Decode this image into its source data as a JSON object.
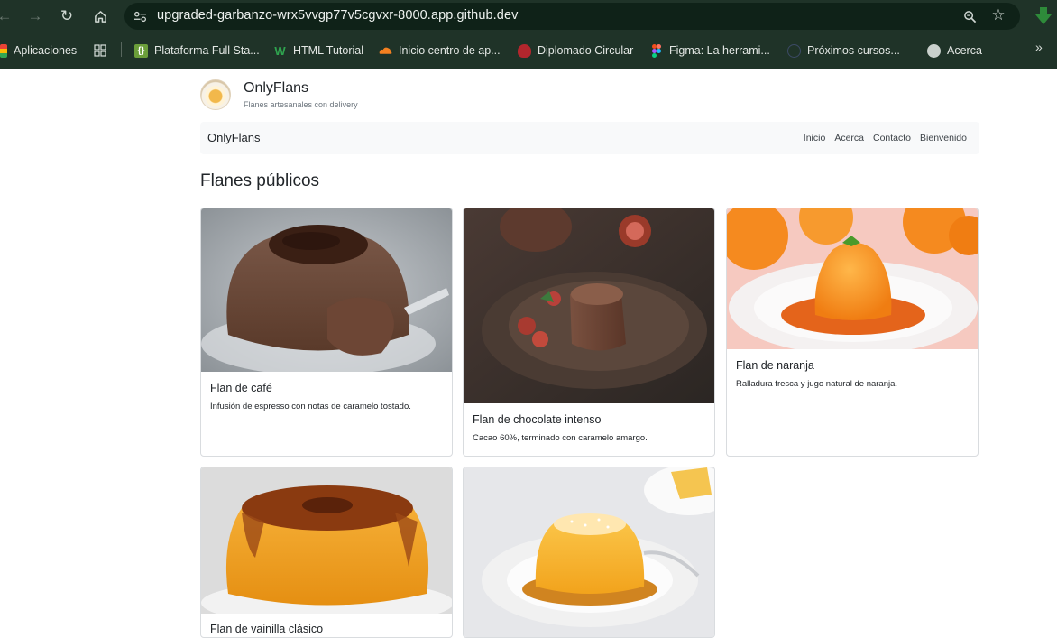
{
  "browser": {
    "url": "upgraded-garbanzo-wrx5vvgp77v5cgvxr-8000.app.github.dev",
    "bookmarks": [
      {
        "label": "Aplicaciones",
        "icon": "apps-grid-icon"
      },
      {
        "label": "Plataforma Full Sta...",
        "icon": "braces-icon"
      },
      {
        "label": "HTML Tutorial",
        "icon": "w3-icon"
      },
      {
        "label": "Inicio centro de ap...",
        "icon": "cloud-icon"
      },
      {
        "label": "Diplomado Circular",
        "icon": "crest-icon"
      },
      {
        "label": "Figma: La herrami...",
        "icon": "figma-icon"
      },
      {
        "label": "Próximos cursos...",
        "icon": "globe-dark-icon"
      },
      {
        "label": "Acerca",
        "icon": "globe-icon"
      }
    ]
  },
  "site": {
    "title": "OnlyFlans",
    "subtitle": "Flanes artesanales con delivery",
    "navbar_brand": "OnlyFlans",
    "nav_links": [
      "Inicio",
      "Acerca",
      "Contacto",
      "Bienvenido"
    ],
    "section_title": "Flanes públicos"
  },
  "cards": [
    {
      "title": "Flan de café",
      "description": "Infusión de espresso con notas de caramelo tostado.",
      "image": "coffee-flan-photo"
    },
    {
      "title": "Flan de chocolate intenso",
      "description": "Cacao 60%, terminado con caramelo amargo.",
      "image": "chocolate-flan-photo"
    },
    {
      "title": "Flan de naranja",
      "description": "Ralladura fresca y jugo natural de naranja.",
      "image": "orange-flan-photo"
    },
    {
      "title": "Flan de vainilla clásico",
      "description": "",
      "image": "vanilla-flan-photo"
    },
    {
      "title": "",
      "description": "",
      "image": "coconut-flan-photo"
    }
  ]
}
